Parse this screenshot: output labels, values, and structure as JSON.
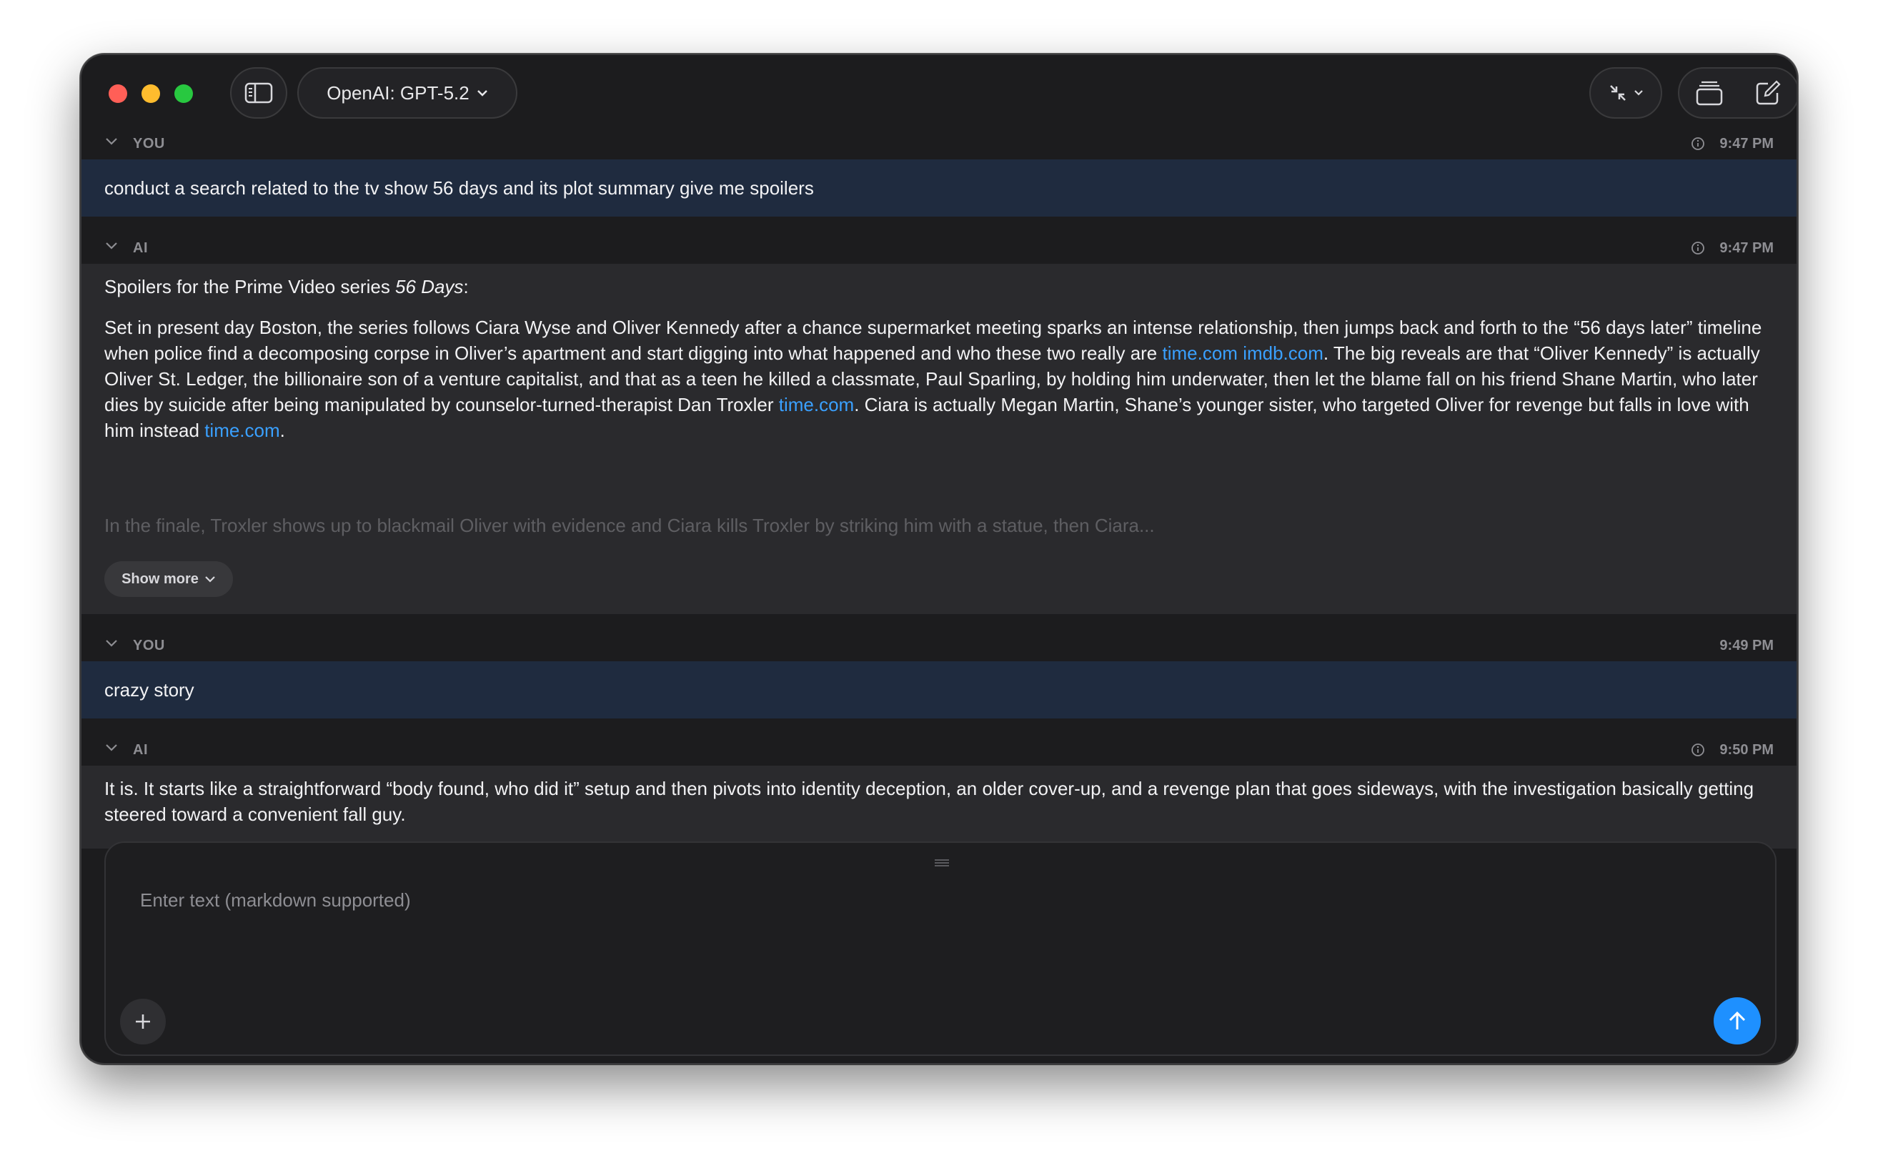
{
  "app": {
    "model_label": "OpenAI: GPT-5.2"
  },
  "messages": [
    {
      "role": "YOU",
      "time": "9:47 PM",
      "text": "conduct a search related to the tv show 56 days and its plot summary give me spoilers"
    },
    {
      "role": "AI",
      "time": "9:47 PM",
      "intro_prefix": "Spoilers for the Prime Video series ",
      "intro_italic": "56 Days",
      "intro_suffix": ":",
      "p1_a": "Set in present day Boston, the series follows Ciara Wyse and Oliver Kennedy after a chance supermarket meeting sparks an intense relationship, then jumps back and forth to the “56 days later” timeline when police find a decomposing corpse in Oliver’s apartment and start digging into what happened and who these two really are ",
      "p1_link1": "time.com",
      "p1_link2": "imdb.com",
      "p1_b": ". The big reveals are that “Oliver Kennedy” is actually Oliver St. Ledger, the billionaire son of a venture capitalist, and that as a teen he killed a classmate, Paul Sparling, by holding him underwater, then let the blame fall on his friend Shane Martin, who later dies by suicide after being manipulated by counselor-turned-therapist Dan Troxler ",
      "p1_link3": "time.com",
      "p1_c": ". Ciara is actually Megan Martin, Shane’s younger sister, who targeted Oliver for revenge but falls in love with him instead ",
      "p1_link4": "time.com",
      "p1_d": ".",
      "p2_faded": "In the finale, Troxler shows up to blackmail Oliver with evidence and Ciara kills Troxler by striking him with a statue, then Ciara...",
      "show_more": "Show more"
    },
    {
      "role": "YOU",
      "time": "9:49 PM",
      "text": "crazy story"
    },
    {
      "role": "AI",
      "time": "9:50 PM",
      "text": "It is. It starts like a straightforward “body found, who did it” setup and then pivots into identity deception, an older cover-up, and a revenge plan that goes sideways, with the investigation basically getting steered toward a convenient fall guy."
    }
  ],
  "composer": {
    "placeholder": "Enter text (markdown supported)",
    "value": ""
  },
  "colors": {
    "accent": "#1e90ff",
    "link": "#3aa0ff",
    "user_bg": "#1f2b3f",
    "ai_bg": "#2a2a2d",
    "window_bg": "#1c1c1e"
  },
  "icons": {
    "sidebar": "sidebar-toggle-icon",
    "model_dropdown": "chevron-down-icon",
    "collapse": "collapse-arrows-icon",
    "windows": "windows-stack-icon",
    "compose": "compose-icon",
    "info": "info-icon",
    "plus": "plus-icon",
    "send": "arrow-up-icon"
  }
}
